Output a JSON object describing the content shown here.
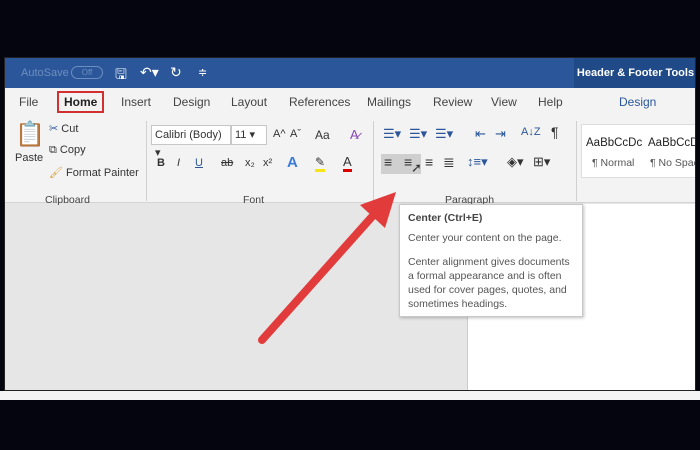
{
  "titlebar": {
    "autosave": "AutoSave",
    "autosave_state": "Off",
    "contextual_title": "Header & Footer Tools",
    "accent": "#2b579a"
  },
  "tabs": [
    "File",
    "Home",
    "Insert",
    "Design",
    "Layout",
    "References",
    "Mailings",
    "Review",
    "View",
    "Help"
  ],
  "contextual_tab": "Design",
  "clipboard": {
    "paste": "Paste",
    "cut": "Cut",
    "copy": "Copy",
    "format_painter": "Format Painter",
    "label": "Clipboard"
  },
  "font": {
    "name": "Calibri (Body)",
    "size": "11",
    "change_case": "Aa",
    "bold": "B",
    "italic": "I",
    "underline": "U",
    "strike": "ab",
    "subscript": "x₂",
    "superscript": "x²",
    "text_effects": "A",
    "font_color": "A",
    "grow": "A^",
    "shrink": "Aˇ",
    "label": "Font"
  },
  "paragraph": {
    "label": "Paragraph",
    "sort": "A↓Z",
    "pilcrow": "¶"
  },
  "styles": [
    {
      "preview": "AaBbCcDc",
      "name": "¶ Normal"
    },
    {
      "preview": "AaBbCcDc",
      "name": "¶ No Spac..."
    }
  ],
  "tooltip": {
    "title": "Center (Ctrl+E)",
    "line1": "Center your content on the page.",
    "line2": "Center alignment gives documents a formal appearance and is often used for cover pages, quotes, and sometimes headings."
  },
  "annotation_color": "#e23b3b"
}
